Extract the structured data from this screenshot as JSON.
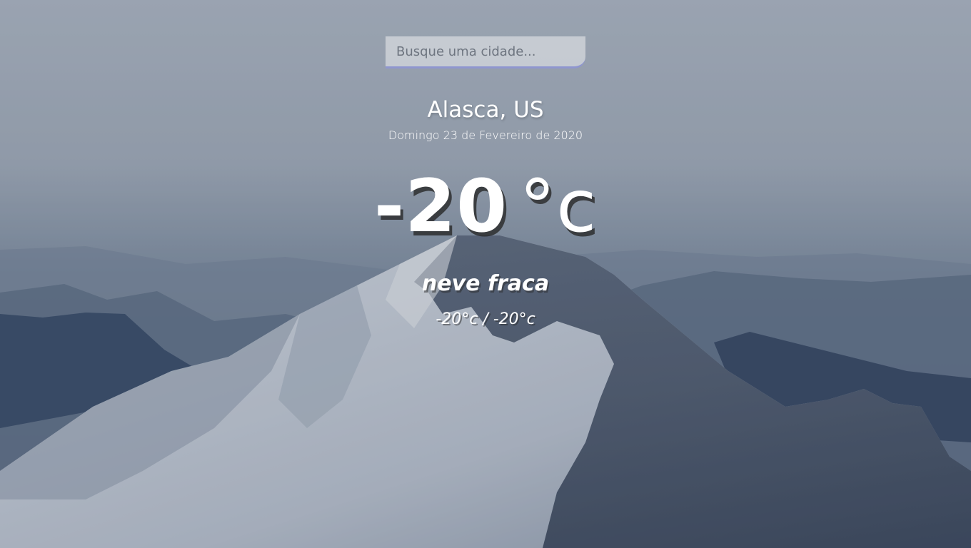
{
  "search": {
    "placeholder": "Busque uma cidade..."
  },
  "location": {
    "name": "Alasca, US",
    "date": "Domingo 23 de Fevereiro de 2020"
  },
  "weather": {
    "temp_value": "-20",
    "temp_unit": "°c",
    "description": "neve fraca",
    "hi_low": "-20°c / -20°c"
  },
  "background": {
    "image_subject": "snowy-mountain-icon"
  }
}
